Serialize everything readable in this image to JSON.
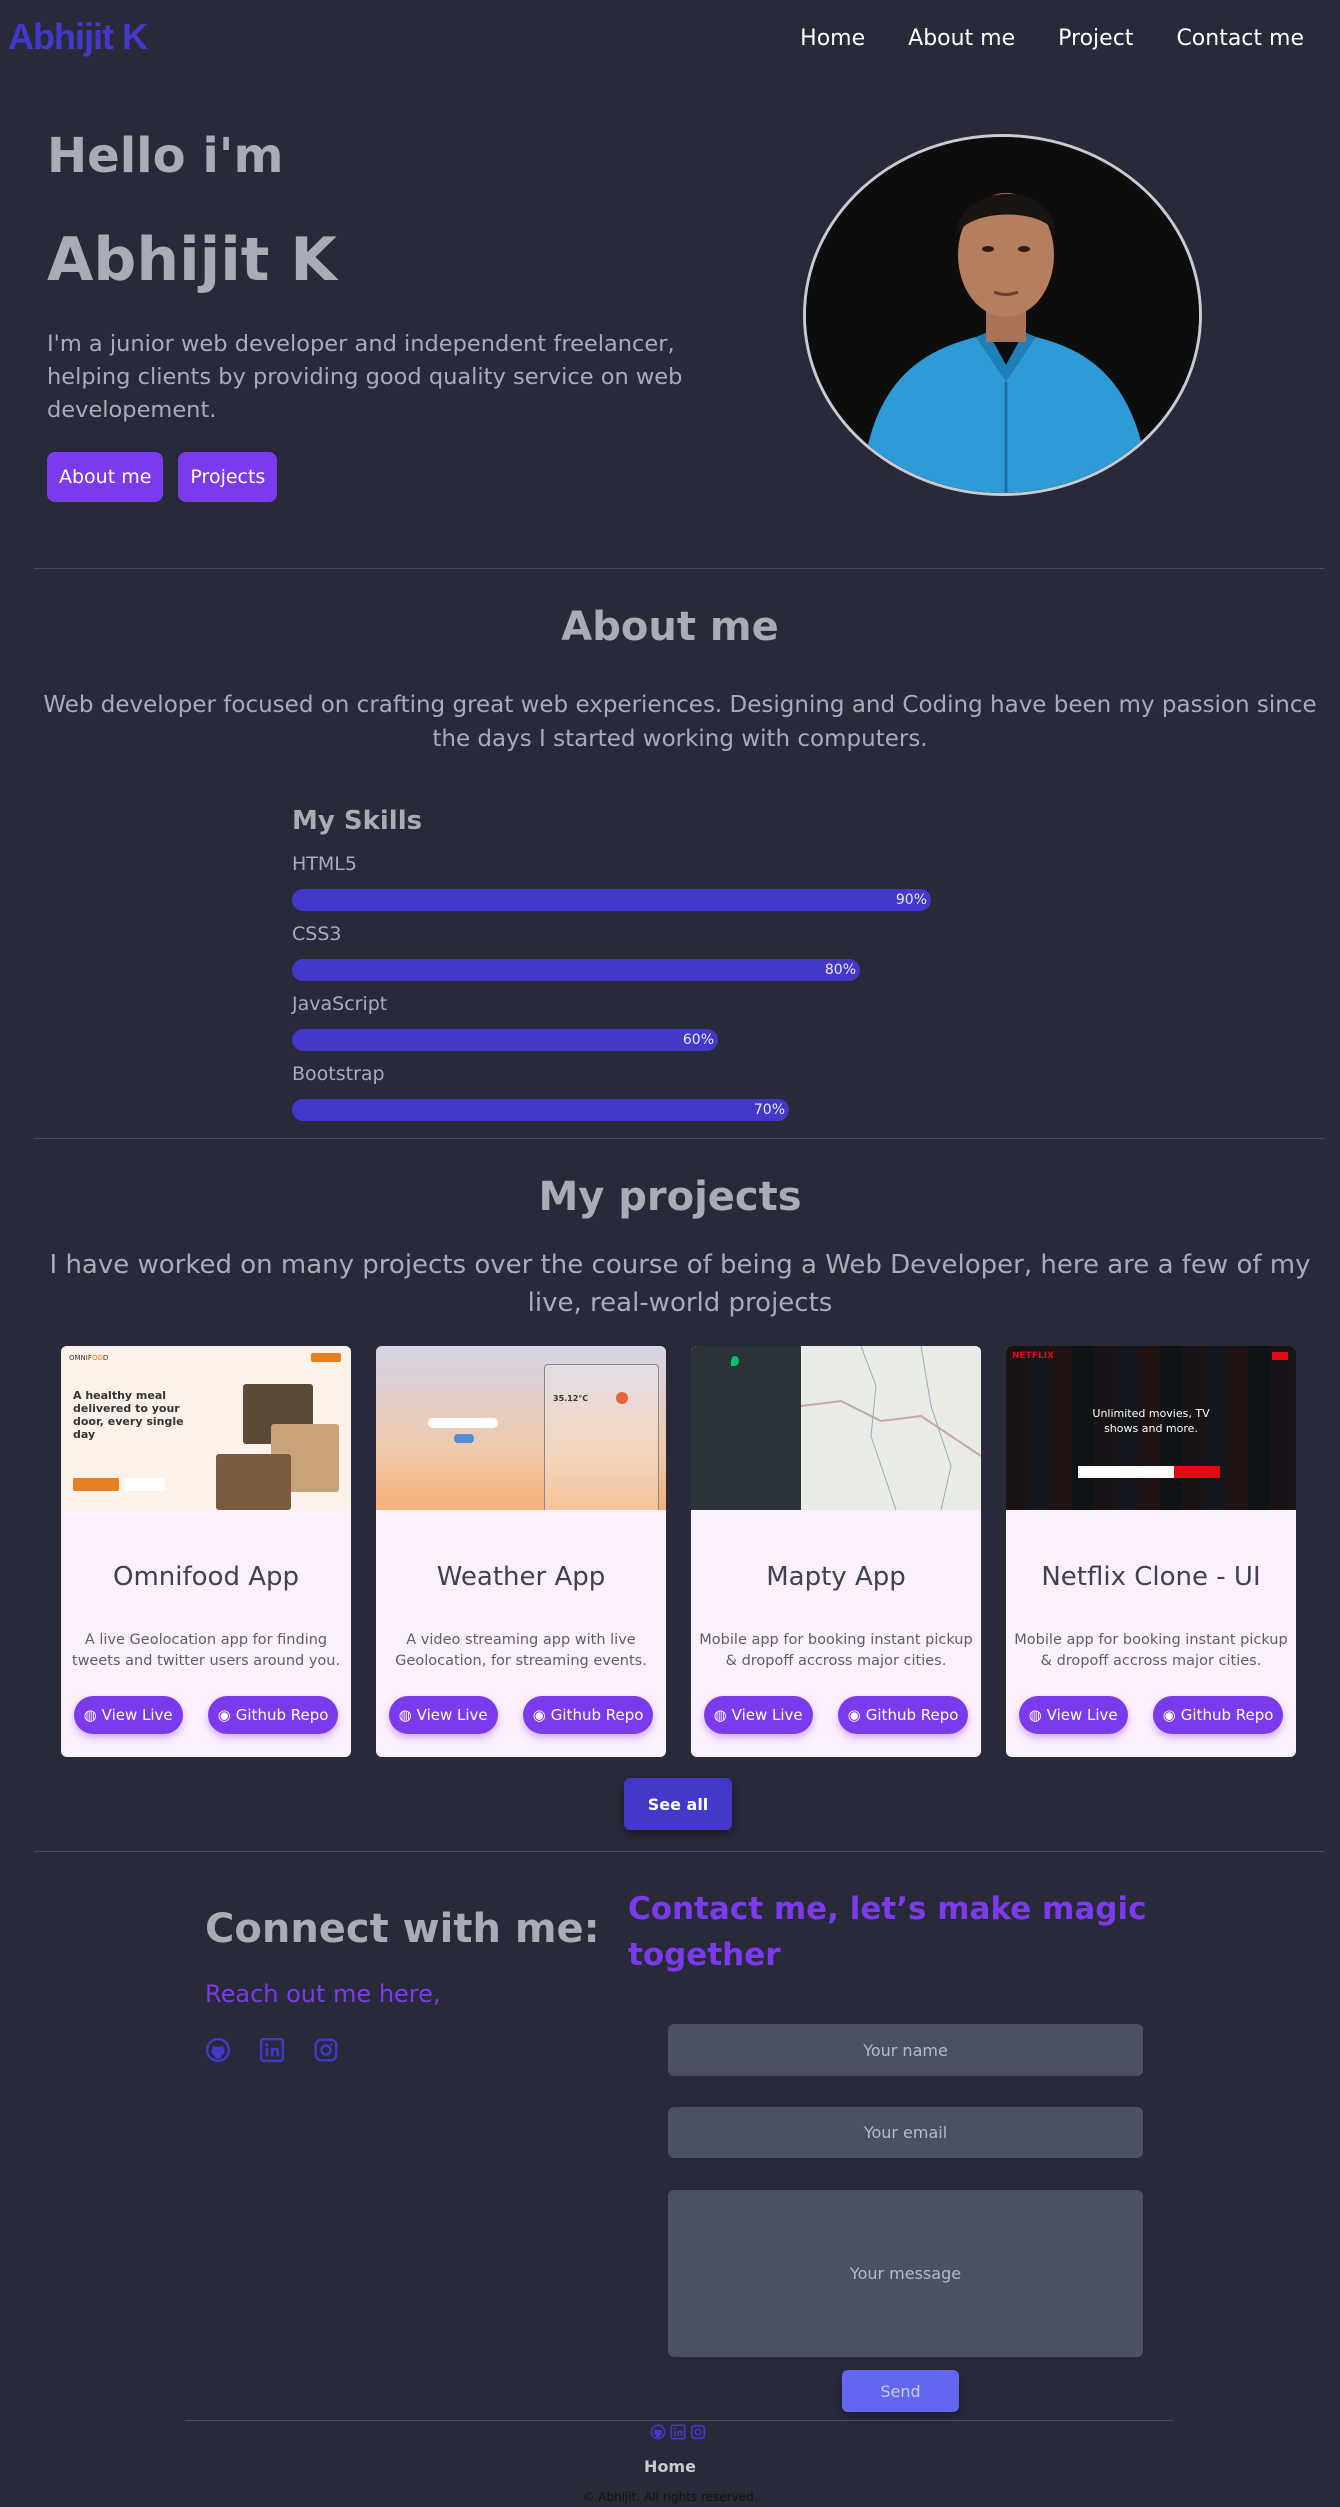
{
  "nav": {
    "logo": "Abhijit K",
    "links": [
      "Home",
      "About me",
      "Project",
      "Contact me"
    ]
  },
  "hero": {
    "hello": "Hello i'm",
    "name": "Abhijit K",
    "description": "I'm a junior web developer and independent freelancer, helping clients by providing good quality service on web developement.",
    "buttons": [
      "About me",
      "Projects"
    ]
  },
  "about": {
    "title": "About me",
    "text": "Web developer focused on crafting great web experiences. Designing and Coding have been my passion since the days I started working with computers.",
    "skills_title": "My Skills",
    "skills": [
      {
        "name": "HTML5",
        "level": 90,
        "label": "90%"
      },
      {
        "name": "CSS3",
        "level": 80,
        "label": "80%"
      },
      {
        "name": "JavaScript",
        "level": 60,
        "label": "60%"
      },
      {
        "name": "Bootstrap",
        "level": 70,
        "label": "70%"
      }
    ]
  },
  "projects": {
    "title": "My projects",
    "intro": "I have worked on many projects over the course of being a Web Developer, here are a few of my live, real-world projects",
    "cards": [
      {
        "title": "Omnifood App",
        "description": "A live Geolocation app for finding tweets and twitter users around you.",
        "live": "View Live",
        "repo": "Github Repo"
      },
      {
        "title": "Weather App",
        "description": "A video streaming app with live Geolocation, for streaming events.",
        "live": "View Live",
        "repo": "Github Repo"
      },
      {
        "title": "Mapty App",
        "description": "Mobile app for booking instant pickup & dropoff accross major cities.",
        "live": "View Live",
        "repo": "Github Repo"
      },
      {
        "title": "Netflix Clone - UI",
        "description": "Mobile app for booking instant pickup & dropoff accross major cities.",
        "live": "View Live",
        "repo": "Github Repo"
      }
    ],
    "thumbs": {
      "omnifood_headline": "A healthy meal delivered to your door, every single day",
      "weather_temp": "35.12°C",
      "netflix_headline": "Unlimited movies, TV shows and more."
    },
    "see_all": "See all"
  },
  "contact": {
    "connect_title": "Connect with me:",
    "reach": "Reach out me here,",
    "social_icons": [
      "github-icon",
      "linkedin-icon",
      "instagram-icon"
    ],
    "form_title": "Contact me, let’s make magic together",
    "name_placeholder": "Your name",
    "email_placeholder": "Your email",
    "message_placeholder": "Your message",
    "send": "Send"
  },
  "footer": {
    "home": "Home",
    "copyright": "© Abhijit. All rights reserved."
  },
  "colors": {
    "background": "#282a3a",
    "primary_purple": "#7c3aed",
    "indigo": "#4338ca",
    "card": "#fdf0fd"
  }
}
